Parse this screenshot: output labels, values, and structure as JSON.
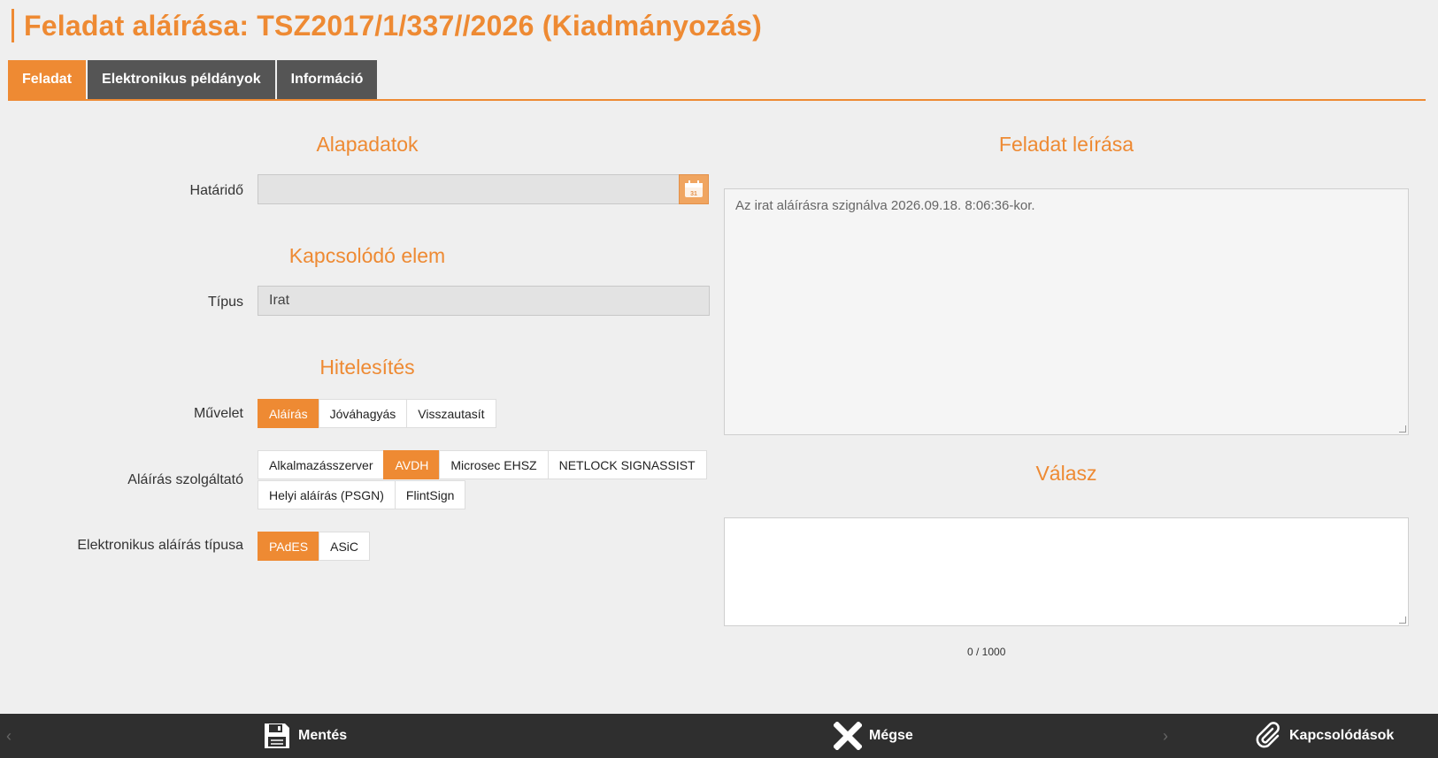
{
  "page": {
    "title": "Feladat aláírása: TSZ2017/1/337//2026 (Kiadmányozás)"
  },
  "tabs": [
    {
      "label": "Feladat",
      "active": true
    },
    {
      "label": "Elektronikus példányok",
      "active": false
    },
    {
      "label": "Információ",
      "active": false
    }
  ],
  "alapadatok": {
    "title": "Alapadatok",
    "hatarido_label": "Határidő",
    "hatarido_value": "",
    "calendar_icon": "calendar-icon"
  },
  "kapcsolodo": {
    "title": "Kapcsolódó elem",
    "tipus_label": "Típus",
    "tipus_value": "Irat"
  },
  "hitelesites": {
    "title": "Hitelesítés",
    "muvelet_label": "Művelet",
    "muvelet_options": [
      "Aláírás",
      "Jóváhagyás",
      "Visszautasít"
    ],
    "muvelet_selected": "Aláírás",
    "szolgaltato_label": "Aláírás szolgáltató",
    "szolgaltato_options_row1": [
      "Alkalmazásszerver",
      "AVDH",
      "Microsec EHSZ",
      "NETLOCK SIGNASSIST"
    ],
    "szolgaltato_options_row2": [
      "Helyi aláírás (PSGN)",
      "FlintSign"
    ],
    "szolgaltato_selected": "AVDH",
    "tipus_label": "Elektronikus aláírás típusa",
    "tipus_options": [
      "PAdES",
      "ASiC"
    ],
    "tipus_selected": "PAdES"
  },
  "leiras": {
    "title": "Feladat leírása",
    "text": "Az irat aláírásra szignálva 2026.09.18. 8:06:36-kor."
  },
  "valasz": {
    "title": "Válasz",
    "value": "",
    "counter": "0 / 1000"
  },
  "bottom_bar": {
    "save_label": "Mentés",
    "cancel_label": "Mégse",
    "attachments_label": "Kapcsolódások",
    "prev_arrow": "‹",
    "next_arrow": "›"
  },
  "colors": {
    "accent": "#ee8a33",
    "tab_inactive": "#555555",
    "bottom_bar": "#2f2f2f"
  }
}
